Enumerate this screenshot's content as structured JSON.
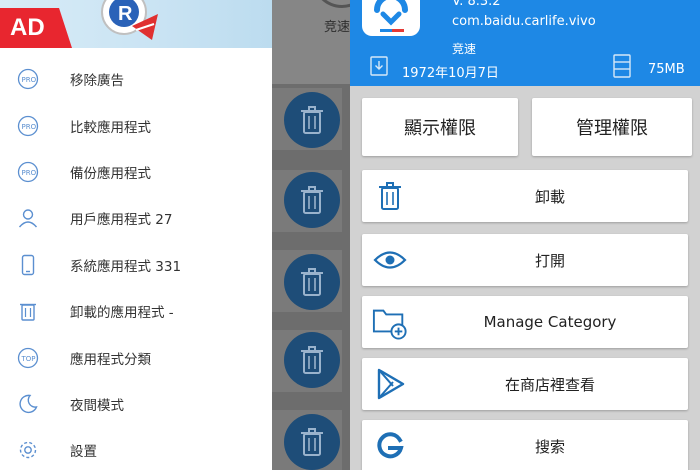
{
  "drawer": {
    "ad_badge": "AD",
    "items": [
      {
        "label": "移除廣告",
        "icon": "pro-icon"
      },
      {
        "label": "比較應用程式",
        "icon": "pro-icon"
      },
      {
        "label": "備份應用程式",
        "icon": "pro-icon"
      },
      {
        "label": "用戶應用程式 27",
        "icon": "user-icon"
      },
      {
        "label": "系統應用程式 331",
        "icon": "phone-icon"
      },
      {
        "label": "卸載的應用程式 -",
        "icon": "trash-icon"
      },
      {
        "label": "應用程式分類",
        "icon": "top-icon"
      },
      {
        "label": "夜間模式",
        "icon": "moon-icon"
      },
      {
        "label": "設置",
        "icon": "gear-icon"
      }
    ]
  },
  "middle": {
    "top_label": "竞速"
  },
  "app": {
    "version": "V. 8.3.2",
    "package": "com.baidu.carlife.vivo",
    "name": "竞速",
    "date": "1972年10月7日",
    "size": "75MB"
  },
  "permissions": {
    "show_label": "顯示權限",
    "manage_label": "管理權限"
  },
  "actions": {
    "uninstall": "卸載",
    "open": "打開",
    "manage_category": "Manage Category",
    "view_in_store": "在商店裡查看",
    "search": "搜索"
  },
  "colors": {
    "header_blue": "#1e88e5",
    "icon_blue": "#1e6fb5",
    "ad_red": "#e8262f",
    "dim_circle": "#1e4d78"
  }
}
